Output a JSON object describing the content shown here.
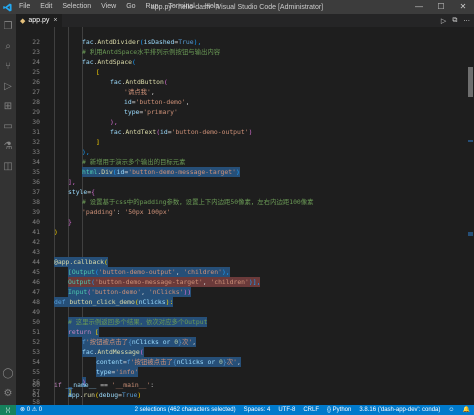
{
  "window": {
    "title": "app.py - hello-dash - Visual Studio Code [Administrator]",
    "menu": [
      "File",
      "Edit",
      "Selection",
      "View",
      "Go",
      "Run",
      "Terminal",
      "Help"
    ],
    "controls": [
      "—",
      "☐",
      "✕"
    ]
  },
  "tab": {
    "label": "app.py",
    "close": "×"
  },
  "editor_actions": [
    "▷",
    "⧉",
    "···"
  ],
  "code": {
    "line_numbers": [
      "22",
      "23",
      "24",
      "25",
      "26",
      "27",
      "28",
      "29",
      "30",
      "31",
      "32",
      "33",
      "34",
      "35",
      "36",
      "37",
      "38",
      "39",
      "40",
      "41",
      "42",
      "43",
      "44",
      "45",
      "46",
      "47",
      "48",
      "49",
      "50",
      "51",
      "52",
      "53",
      "54",
      "55",
      "56",
      "57",
      "58",
      "59"
    ],
    "l22": {
      "cls": "fac",
      "dot": ".",
      "fn": "AntdDivider",
      "p1": "(",
      "kw": "isDashed",
      "eq": "=",
      "val": "True",
      "p2": "),"
    },
    "l23": {
      "cm": "# 利用AntdSpace水平排列示例按钮与输出内容"
    },
    "l24": {
      "cls": "fac",
      "dot": ".",
      "fn": "AntdSpace",
      "p": "("
    },
    "l25": {
      "b": "["
    },
    "l26": {
      "cls": "fac",
      "dot": ".",
      "fn": "AntdButton",
      "p": "("
    },
    "l27": {
      "str": "'请点我'",
      "c": ","
    },
    "l28": {
      "kw": "id",
      "eq": "=",
      "str": "'button-demo'",
      "c": ","
    },
    "l29": {
      "kw": "type",
      "eq": "=",
      "str": "'primary'"
    },
    "l30": {
      "p": "),"
    },
    "l31": {
      "cls": "fac",
      "dot": ".",
      "fn": "AntdText",
      "p1": "(",
      "kw": "id",
      "eq": "=",
      "str": "'button-demo-output'",
      "p2": ")"
    },
    "l32": {
      "b": "]"
    },
    "l33": {
      "p": "),"
    },
    "l34": {
      "cm": "# 新增用于演示多个输出的目标元素"
    },
    "l35": {
      "cls": "html",
      "dot": ".",
      "fn": "Div",
      "p1": "(",
      "kw": "id",
      "eq": "=",
      "str": "'button-demo-message-target'",
      "p2": ")"
    },
    "l36": {
      "p": "],"
    },
    "l37": {
      "kw": "style",
      "eq": "=",
      "b": "{"
    },
    "l38": {
      "cm": "# 设置基于css中的padding参数，设置上下内边距50像素，左右内边距100像素"
    },
    "l39": {
      "str": "'padding'",
      "c": ": ",
      "val": "'50px 100px'"
    },
    "l40": {
      "b": "}"
    },
    "l41": {
      "b": ")"
    },
    "l42": {
      "t": ""
    },
    "l43": {
      "t": ""
    },
    "l44": {
      "dec": "@app.callback",
      "p": "("
    },
    "l45": {
      "cls": "[Output",
      "p1": "(",
      "s1": "'button-demo-output'",
      "c": ", ",
      "s2": "'children'",
      "p2": "),"
    },
    "l46": {
      "cls": "Output",
      "p1": "(",
      "s1": "'button-demo-message-target'",
      "c": ", ",
      "s2": "'children'",
      "p2": ")],"
    },
    "l47": {
      "cls": "Input",
      "p1": "(",
      "s1": "'button-demo'",
      "c": ", ",
      "s2": "'nClicks'",
      "p2": "))"
    },
    "l48": {
      "def": "def",
      "fn": "button_click_demo",
      "p1": "(",
      "arg": "nClicks",
      "p2": "):"
    },
    "l49": {
      "t": ""
    },
    "l50": {
      "cm": "# 这里示例返回多个结果，依次对应多个Output"
    },
    "l51": {
      "kw": "return",
      "b": "["
    },
    "l52": {
      "fp": "f",
      "str": "'按钮被点击了",
      "b1": "{",
      "v": "nClicks or ",
      "n": "0",
      "b2": "}",
      "str2": "次'",
      "c": ","
    },
    "l53": {
      "cls": "fac",
      "dot": ".",
      "fn": "AntdMessage",
      "p": "("
    },
    "l54": {
      "kw": "content",
      "eq": "=",
      "fp": "f",
      "str": "'按钮被点击了",
      "b1": "{",
      "v": "nClicks or ",
      "n": "0",
      "b2": "}",
      "str2": "次'",
      "c": ","
    },
    "l55": {
      "kw": "type",
      "eq": "=",
      "str": "'info'"
    },
    "l56": {
      "p": ")"
    },
    "l57": {
      "b": "]"
    },
    "l58": {
      "t": ""
    },
    "l59": {
      "t": ""
    },
    "l60": {
      "kw": "if",
      "v": " __name__ ",
      "op": "==",
      "str": " '__main__'",
      "c": ":"
    },
    "l61": {
      "obj": "app",
      "dot": ".",
      "fn": "run",
      "p1": "(",
      "kw": "debug",
      "eq": "=",
      "val": "True",
      "p2": ")"
    }
  },
  "extra_line_numbers": [
    "60",
    "61"
  ],
  "status": {
    "remote": "⟩⟨",
    "errors": "⊗ 0 ⚠ 0",
    "selection": "2 selections (462 characters selected)",
    "spaces": "Spaces: 4",
    "encoding": "UTF-8",
    "eol": "CRLF",
    "language": "{} Python",
    "interpreter": "3.8.16 ('dash-app-dev': conda)",
    "feedback": "☺",
    "bell": "🔔"
  }
}
